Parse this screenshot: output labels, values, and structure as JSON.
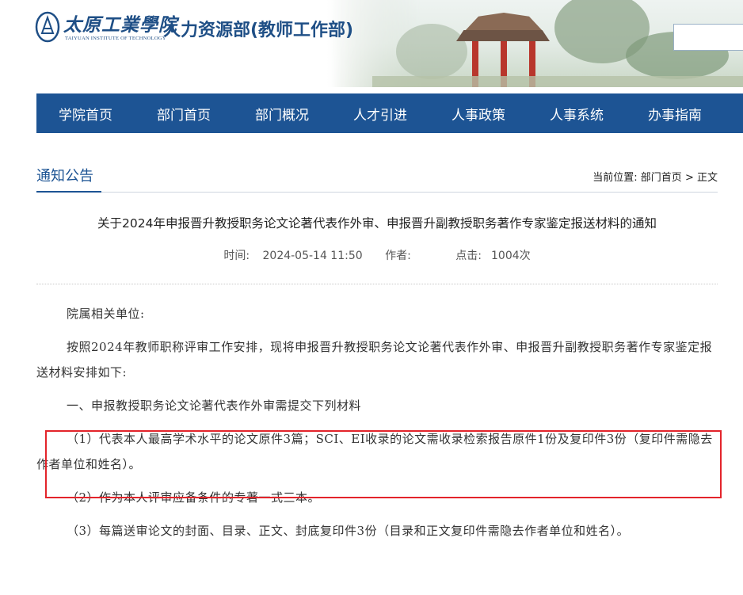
{
  "header": {
    "logo_cn": "太原工業學院",
    "logo_en": "TAIYUAN INSTITUTE OF TECHNOLOGY",
    "dept_title": "人力资源部(教师工作部)"
  },
  "nav": {
    "items": [
      "学院首页",
      "部门首页",
      "部门概况",
      "人才引进",
      "人事政策",
      "人事系统",
      "办事指南"
    ]
  },
  "section": {
    "title": "通知公告",
    "breadcrumb_prefix": "当前位置:",
    "breadcrumb_home": "部门首页",
    "breadcrumb_sep": ">",
    "breadcrumb_current": "正文"
  },
  "article": {
    "title": "关于2024年申报晋升教授职务论文论著代表作外审、申报晋升副教授职务著作专家鉴定报送材料的通知",
    "time_label": "时间:",
    "time_value": "2024-05-14 11:50",
    "author_label": "作者:",
    "author_value": "",
    "clicks_label": "点击:",
    "clicks_value": "1004次",
    "paragraphs": [
      "院属相关单位:",
      "按照2024年教师职称评审工作安排，现将申报晋升教授职务论文论著代表作外审、申报晋升副教授职务著作专家鉴定报送材料安排如下:",
      "一、申报教授职务论文论著代表作外审需提交下列材料",
      "（1）代表本人最高学术水平的论文原件3篇；SCI、EI收录的论文需收录检索报告原件1份及复印件3份（复印件需隐去作者单位和姓名）。",
      "（2）作为本人评审应备条件的专著一式三本。",
      "（3）每篇送审论文的封面、目录、正文、封底复印件3份（目录和正文复印件需隐去作者单位和姓名）。"
    ]
  },
  "colors": {
    "nav_bg": "#1d5494",
    "brand": "#1f4f86",
    "highlight_border": "#e3242b"
  }
}
